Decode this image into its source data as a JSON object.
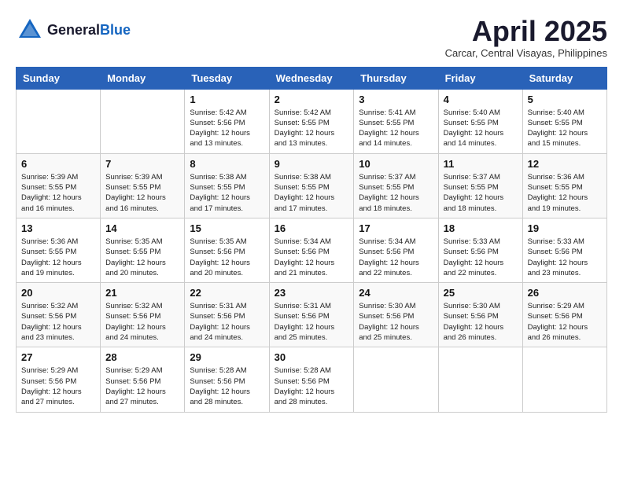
{
  "header": {
    "logo_general": "General",
    "logo_blue": "Blue",
    "month_title": "April 2025",
    "location": "Carcar, Central Visayas, Philippines"
  },
  "weekdays": [
    "Sunday",
    "Monday",
    "Tuesday",
    "Wednesday",
    "Thursday",
    "Friday",
    "Saturday"
  ],
  "weeks": [
    [
      {
        "day": "",
        "sunrise": "",
        "sunset": "",
        "daylight": ""
      },
      {
        "day": "",
        "sunrise": "",
        "sunset": "",
        "daylight": ""
      },
      {
        "day": "1",
        "sunrise": "Sunrise: 5:42 AM",
        "sunset": "Sunset: 5:56 PM",
        "daylight": "Daylight: 12 hours and 13 minutes."
      },
      {
        "day": "2",
        "sunrise": "Sunrise: 5:42 AM",
        "sunset": "Sunset: 5:55 PM",
        "daylight": "Daylight: 12 hours and 13 minutes."
      },
      {
        "day": "3",
        "sunrise": "Sunrise: 5:41 AM",
        "sunset": "Sunset: 5:55 PM",
        "daylight": "Daylight: 12 hours and 14 minutes."
      },
      {
        "day": "4",
        "sunrise": "Sunrise: 5:40 AM",
        "sunset": "Sunset: 5:55 PM",
        "daylight": "Daylight: 12 hours and 14 minutes."
      },
      {
        "day": "5",
        "sunrise": "Sunrise: 5:40 AM",
        "sunset": "Sunset: 5:55 PM",
        "daylight": "Daylight: 12 hours and 15 minutes."
      }
    ],
    [
      {
        "day": "6",
        "sunrise": "Sunrise: 5:39 AM",
        "sunset": "Sunset: 5:55 PM",
        "daylight": "Daylight: 12 hours and 16 minutes."
      },
      {
        "day": "7",
        "sunrise": "Sunrise: 5:39 AM",
        "sunset": "Sunset: 5:55 PM",
        "daylight": "Daylight: 12 hours and 16 minutes."
      },
      {
        "day": "8",
        "sunrise": "Sunrise: 5:38 AM",
        "sunset": "Sunset: 5:55 PM",
        "daylight": "Daylight: 12 hours and 17 minutes."
      },
      {
        "day": "9",
        "sunrise": "Sunrise: 5:38 AM",
        "sunset": "Sunset: 5:55 PM",
        "daylight": "Daylight: 12 hours and 17 minutes."
      },
      {
        "day": "10",
        "sunrise": "Sunrise: 5:37 AM",
        "sunset": "Sunset: 5:55 PM",
        "daylight": "Daylight: 12 hours and 18 minutes."
      },
      {
        "day": "11",
        "sunrise": "Sunrise: 5:37 AM",
        "sunset": "Sunset: 5:55 PM",
        "daylight": "Daylight: 12 hours and 18 minutes."
      },
      {
        "day": "12",
        "sunrise": "Sunrise: 5:36 AM",
        "sunset": "Sunset: 5:55 PM",
        "daylight": "Daylight: 12 hours and 19 minutes."
      }
    ],
    [
      {
        "day": "13",
        "sunrise": "Sunrise: 5:36 AM",
        "sunset": "Sunset: 5:55 PM",
        "daylight": "Daylight: 12 hours and 19 minutes."
      },
      {
        "day": "14",
        "sunrise": "Sunrise: 5:35 AM",
        "sunset": "Sunset: 5:55 PM",
        "daylight": "Daylight: 12 hours and 20 minutes."
      },
      {
        "day": "15",
        "sunrise": "Sunrise: 5:35 AM",
        "sunset": "Sunset: 5:56 PM",
        "daylight": "Daylight: 12 hours and 20 minutes."
      },
      {
        "day": "16",
        "sunrise": "Sunrise: 5:34 AM",
        "sunset": "Sunset: 5:56 PM",
        "daylight": "Daylight: 12 hours and 21 minutes."
      },
      {
        "day": "17",
        "sunrise": "Sunrise: 5:34 AM",
        "sunset": "Sunset: 5:56 PM",
        "daylight": "Daylight: 12 hours and 22 minutes."
      },
      {
        "day": "18",
        "sunrise": "Sunrise: 5:33 AM",
        "sunset": "Sunset: 5:56 PM",
        "daylight": "Daylight: 12 hours and 22 minutes."
      },
      {
        "day": "19",
        "sunrise": "Sunrise: 5:33 AM",
        "sunset": "Sunset: 5:56 PM",
        "daylight": "Daylight: 12 hours and 23 minutes."
      }
    ],
    [
      {
        "day": "20",
        "sunrise": "Sunrise: 5:32 AM",
        "sunset": "Sunset: 5:56 PM",
        "daylight": "Daylight: 12 hours and 23 minutes."
      },
      {
        "day": "21",
        "sunrise": "Sunrise: 5:32 AM",
        "sunset": "Sunset: 5:56 PM",
        "daylight": "Daylight: 12 hours and 24 minutes."
      },
      {
        "day": "22",
        "sunrise": "Sunrise: 5:31 AM",
        "sunset": "Sunset: 5:56 PM",
        "daylight": "Daylight: 12 hours and 24 minutes."
      },
      {
        "day": "23",
        "sunrise": "Sunrise: 5:31 AM",
        "sunset": "Sunset: 5:56 PM",
        "daylight": "Daylight: 12 hours and 25 minutes."
      },
      {
        "day": "24",
        "sunrise": "Sunrise: 5:30 AM",
        "sunset": "Sunset: 5:56 PM",
        "daylight": "Daylight: 12 hours and 25 minutes."
      },
      {
        "day": "25",
        "sunrise": "Sunrise: 5:30 AM",
        "sunset": "Sunset: 5:56 PM",
        "daylight": "Daylight: 12 hours and 26 minutes."
      },
      {
        "day": "26",
        "sunrise": "Sunrise: 5:29 AM",
        "sunset": "Sunset: 5:56 PM",
        "daylight": "Daylight: 12 hours and 26 minutes."
      }
    ],
    [
      {
        "day": "27",
        "sunrise": "Sunrise: 5:29 AM",
        "sunset": "Sunset: 5:56 PM",
        "daylight": "Daylight: 12 hours and 27 minutes."
      },
      {
        "day": "28",
        "sunrise": "Sunrise: 5:29 AM",
        "sunset": "Sunset: 5:56 PM",
        "daylight": "Daylight: 12 hours and 27 minutes."
      },
      {
        "day": "29",
        "sunrise": "Sunrise: 5:28 AM",
        "sunset": "Sunset: 5:56 PM",
        "daylight": "Daylight: 12 hours and 28 minutes."
      },
      {
        "day": "30",
        "sunrise": "Sunrise: 5:28 AM",
        "sunset": "Sunset: 5:56 PM",
        "daylight": "Daylight: 12 hours and 28 minutes."
      },
      {
        "day": "",
        "sunrise": "",
        "sunset": "",
        "daylight": ""
      },
      {
        "day": "",
        "sunrise": "",
        "sunset": "",
        "daylight": ""
      },
      {
        "day": "",
        "sunrise": "",
        "sunset": "",
        "daylight": ""
      }
    ]
  ]
}
